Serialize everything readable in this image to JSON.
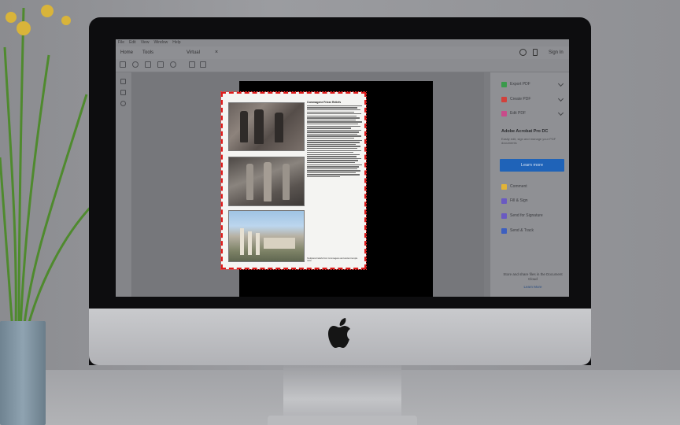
{
  "menubar": [
    "File",
    "Edit",
    "View",
    "Window",
    "Help"
  ],
  "toolbar": {
    "home": "Home",
    "tools": "Tools",
    "tab": "Virtual",
    "sign_in": "Sign In"
  },
  "right_panel": {
    "items": [
      {
        "label": "Export PDF",
        "color": "#3a9a4b",
        "icon": "export-pdf-icon"
      },
      {
        "label": "Create PDF",
        "color": "#d2413b",
        "icon": "create-pdf-icon"
      },
      {
        "label": "Edit PDF",
        "color": "#c84b8a",
        "icon": "edit-pdf-icon"
      }
    ],
    "promo_title": "Adobe Acrobat Pro DC",
    "promo_text": "Easily edit, sign and manage your PDF documents",
    "learn_more": "Learn more",
    "tools": [
      {
        "label": "Comment",
        "color": "#e2b437",
        "icon": "comment-icon"
      },
      {
        "label": "Fill & Sign",
        "color": "#6a5ac2",
        "icon": "fill-sign-icon"
      },
      {
        "label": "Send for Signature",
        "color": "#6a5ac2",
        "icon": "send-signature-icon"
      },
      {
        "label": "Send & Track",
        "color": "#3d5fbf",
        "icon": "send-track-icon"
      }
    ],
    "footer": "Store and share files in the Document Cloud",
    "footer_link": "Learn More"
  },
  "document": {
    "heading": "Commagene Frieze Reliefs",
    "caption": "Sculptured reliefs from Commagene and ancient temple ruins"
  },
  "colors": {
    "highlight_border": "#e01a1a",
    "accent": "#1f63b8"
  }
}
